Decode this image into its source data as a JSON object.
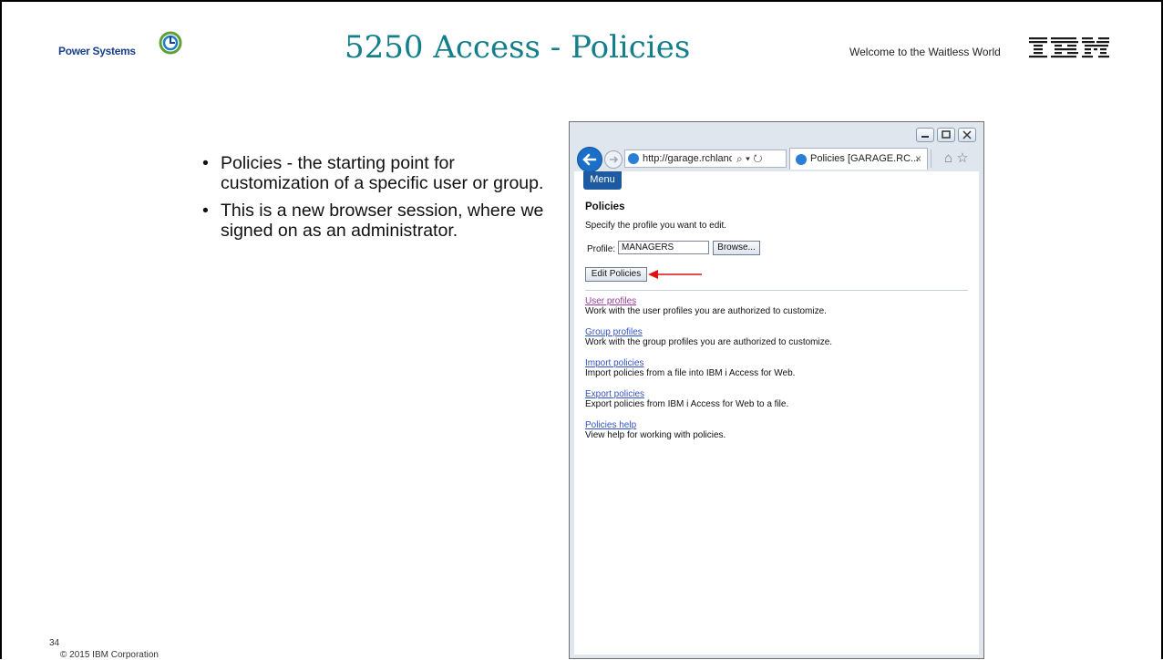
{
  "slide": {
    "brand": "Power Systems",
    "title": "5250 Access - Policies",
    "tagline": "Welcome to the Waitless World",
    "page_number": "34",
    "copyright": "© 2015 IBM Corporation",
    "bullets": [
      "Policies - the starting point for customization of a specific user or group.",
      "This is a new browser session, where we signed on as an administrator."
    ]
  },
  "browser": {
    "url": "http://garage.rchland.",
    "tab_label": "Policies [GARAGE.RC...",
    "tab_close": "×",
    "address_icons": "⌕ ▾ ↻"
  },
  "page": {
    "menu_label": "Menu",
    "title": "Policies",
    "instruction": "Specify the profile you want to edit.",
    "profile_label": "Profile:",
    "profile_value": "MANAGERS",
    "browse_label": "Browse...",
    "edit_label": "Edit Policies",
    "links": [
      {
        "label": "User profiles",
        "desc": "Work with the user profiles you are authorized to customize."
      },
      {
        "label": "Group profiles",
        "desc": "Work with the group profiles you are authorized to customize."
      },
      {
        "label": "Import policies",
        "desc": "Import policies from a file into IBM i Access for Web."
      },
      {
        "label": "Export policies",
        "desc": "Export policies from IBM i Access for Web to a file."
      },
      {
        "label": "Policies help",
        "desc": "View help for working with policies."
      }
    ]
  },
  "colors": {
    "title": "#127f8a",
    "link": "#3355cc",
    "visited_link": "#9a3b9a",
    "menu_button": "#1e5aa0",
    "annotation_arrow": "#e01010"
  }
}
